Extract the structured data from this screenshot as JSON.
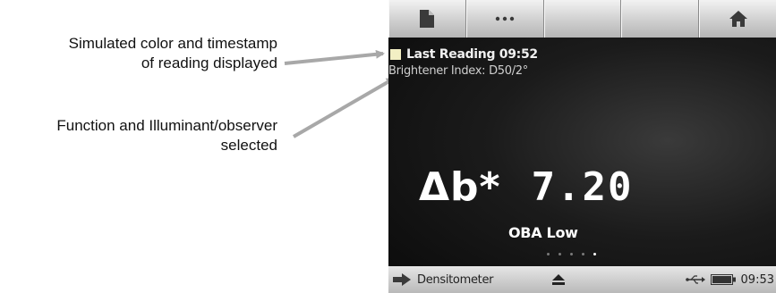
{
  "annotations": {
    "color_timestamp": [
      "Simulated color and timestamp",
      "of reading displayed"
    ],
    "function_illuminant": [
      "Function and Illuminant/observer",
      "selected"
    ]
  },
  "toolbar": {
    "buttons": [
      "document-icon",
      "more-icon",
      "",
      "",
      "home-icon"
    ]
  },
  "reading": {
    "label": "Last Reading 09:52",
    "swatch_color": "#f3efc4"
  },
  "function_line": "Brightener Index: D50/2°",
  "measurement": {
    "metric": "Δb*",
    "value": "7.20",
    "sub_label": "OBA Low"
  },
  "pager": {
    "count": 5,
    "active": 5
  },
  "status": {
    "mode": "Densitometer",
    "time": "09:53",
    "icons": [
      "arrow-right-icon",
      "eject-icon",
      "usb-icon",
      "battery-icon"
    ]
  }
}
